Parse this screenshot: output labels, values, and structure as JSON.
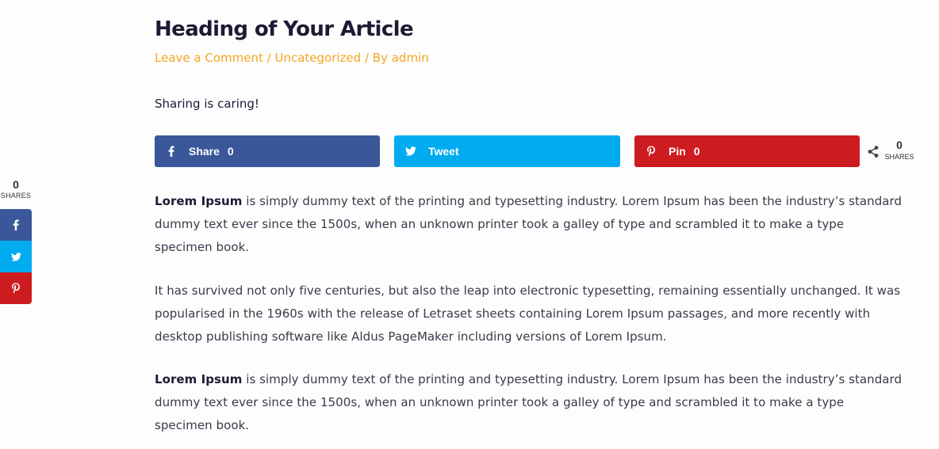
{
  "article": {
    "title": "Heading of Your Article",
    "meta": {
      "comment_link": "Leave a Comment",
      "separator": "/",
      "category_link": "Uncategorized",
      "by_prefix": "/ By",
      "author_link": "admin"
    },
    "sharing_text": "Sharing is caring!",
    "paragraphs": [
      {
        "lead": "Lorem Ipsum",
        "text": " is simply dummy text of the printing and typesetting industry. Lorem Ipsum has been the industry’s standard dummy text ever since the 1500s, when an unknown printer took a galley of type and scrambled it to make a type specimen book."
      },
      {
        "lead": "",
        "text": "It has survived not only five centuries, but also the leap into electronic typesetting, remaining essentially unchanged. It was popularised in the 1960s with the release of Letraset sheets containing Lorem Ipsum passages, and more recently with desktop publishing software like Aldus PageMaker including versions of Lorem Ipsum."
      },
      {
        "lead": "Lorem Ipsum",
        "text": " is simply dummy text of the printing and typesetting industry. Lorem Ipsum has been the industry’s standard dummy text ever since the 1500s, when an unknown printer took a galley of type and scrambled it to make a type specimen book."
      }
    ]
  },
  "share_buttons": {
    "facebook": {
      "label": "Share",
      "count": "0",
      "icon": "facebook-icon",
      "color": "#3a579a"
    },
    "twitter": {
      "label": "Tweet",
      "icon": "twitter-icon",
      "color": "#00abf0"
    },
    "pinterest": {
      "label": "Pin",
      "count": "0",
      "icon": "pinterest-icon",
      "color": "#cd1c1f"
    },
    "total": {
      "count": "0",
      "label": "SHARES",
      "icon": "share-icon"
    }
  },
  "floating_bar": {
    "count": "0",
    "label": "SHARES",
    "buttons": [
      {
        "icon": "facebook-icon",
        "color": "#3a579a"
      },
      {
        "icon": "twitter-icon",
        "color": "#00abf0"
      },
      {
        "icon": "pinterest-icon",
        "color": "#cd1c1f"
      }
    ]
  },
  "colors": {
    "title": "#1f1a33",
    "meta_accent": "#f5a623",
    "body_text": "#3a3a4a"
  }
}
